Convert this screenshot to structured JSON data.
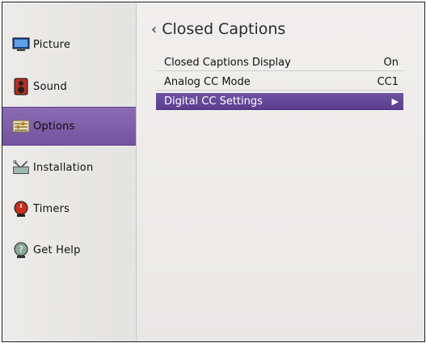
{
  "sidebar": {
    "items": [
      {
        "label": "Picture",
        "icon": "monitor-icon"
      },
      {
        "label": "Sound",
        "icon": "speaker-icon"
      },
      {
        "label": "Options",
        "icon": "options-sliders-icon"
      },
      {
        "label": "Installation",
        "icon": "installation-tools-icon"
      },
      {
        "label": "Timers",
        "icon": "timer-icon"
      },
      {
        "label": "Get Help",
        "icon": "help-icon"
      }
    ],
    "active": "Options"
  },
  "main": {
    "title": "Closed Captions",
    "back_glyph": "‹",
    "rows": [
      {
        "label": "Closed Captions Display",
        "value": "On"
      },
      {
        "label": "Analog CC Mode",
        "value": "CC1"
      },
      {
        "label": "Digital CC Settings",
        "value": "▶"
      }
    ]
  },
  "colors": {
    "accent": "#6f52a1",
    "sidebar_active": "#7f61ab",
    "background": "#eeedec"
  }
}
